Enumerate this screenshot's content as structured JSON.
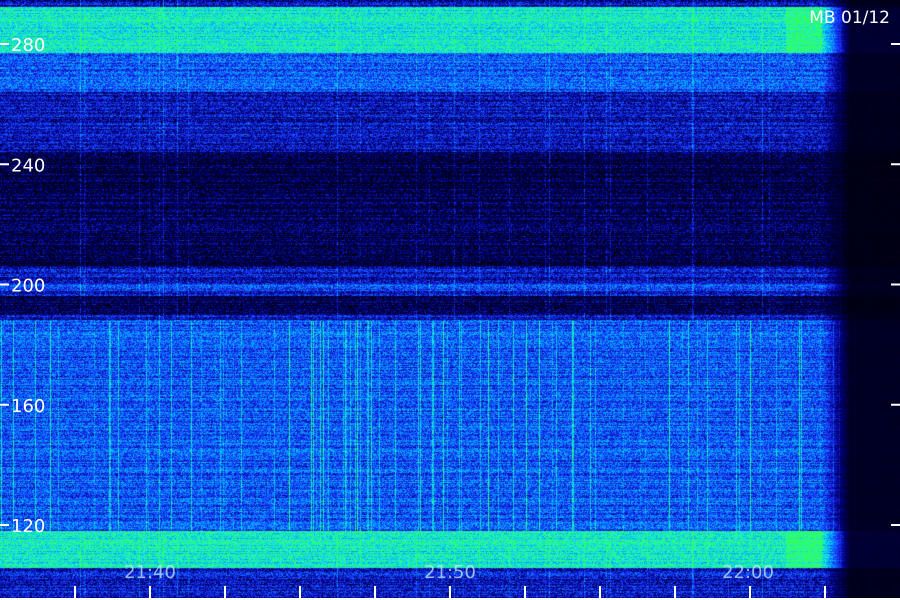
{
  "chart_data": {
    "type": "heatmap",
    "title": "MB 01/12",
    "y_ticks": [
      120,
      160,
      200,
      240,
      280
    ],
    "ylim": [
      106,
      292
    ],
    "x_ticks": [
      "21:40",
      "21:50",
      "22:00"
    ],
    "x_minor_tick_count": 11,
    "intensity_colormap": [
      "#000010",
      "#00007a",
      "#1a33ff",
      "#00a8ff",
      "#1df0d0",
      "#33ff55"
    ],
    "bands": [
      {
        "y_range": [
          277,
          292
        ],
        "level": "high"
      },
      {
        "y_range": [
          264,
          277
        ],
        "level": "medium"
      },
      {
        "y_range": [
          244,
          264
        ],
        "level": "low"
      },
      {
        "y_range": [
          206,
          244
        ],
        "level": "very-low"
      },
      {
        "y_range": [
          198,
          200
        ],
        "level": "medium"
      },
      {
        "y_range": [
          190,
          196
        ],
        "level": "very-low"
      },
      {
        "y_range": [
          118,
          188
        ],
        "level": "medium"
      },
      {
        "y_range": [
          106,
          118
        ],
        "level": "high"
      }
    ]
  }
}
